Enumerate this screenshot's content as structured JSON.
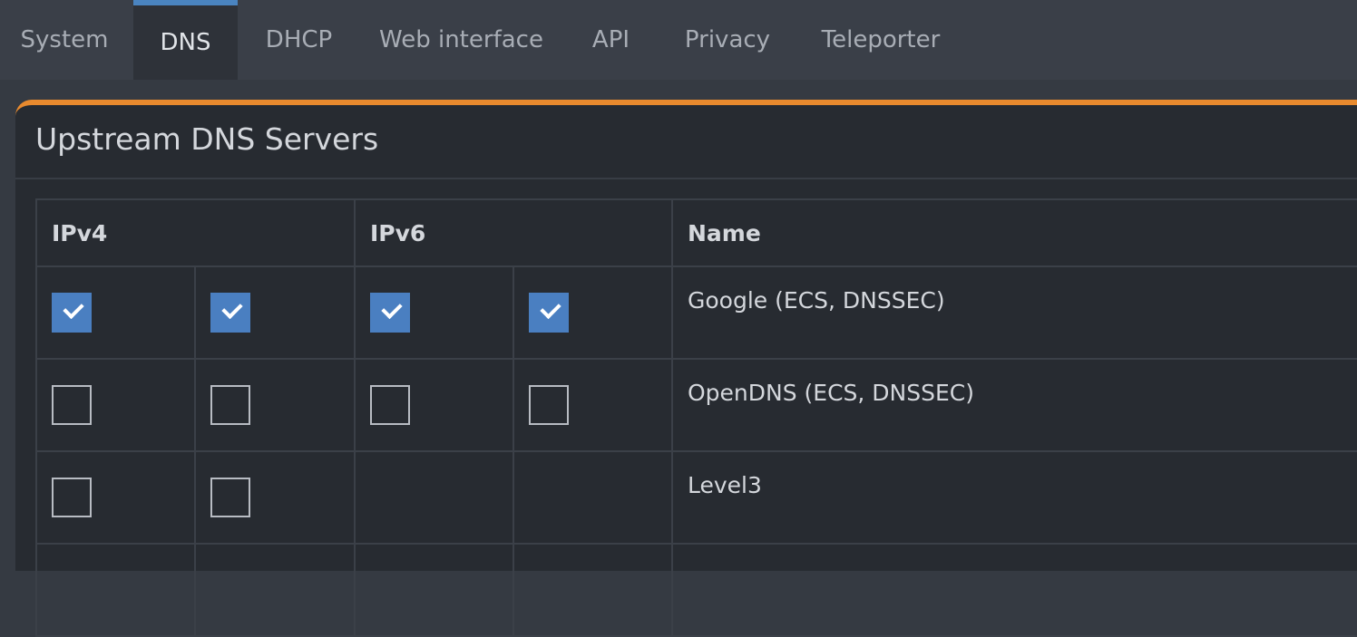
{
  "tabs": [
    {
      "label": "System",
      "active": false
    },
    {
      "label": "DNS",
      "active": true
    },
    {
      "label": "DHCP",
      "active": false
    },
    {
      "label": "Web interface",
      "active": false
    },
    {
      "label": "API",
      "active": false
    },
    {
      "label": "Privacy",
      "active": false
    },
    {
      "label": "Teleporter",
      "active": false
    }
  ],
  "box": {
    "title": "Upstream DNS Servers"
  },
  "table": {
    "headers": {
      "ipv4": "IPv4",
      "ipv6": "IPv6",
      "name": "Name"
    },
    "rows": [
      {
        "name": "Google (ECS, DNSSEC)",
        "ipv4_1": true,
        "ipv4_2": true,
        "ipv6_1": true,
        "ipv6_2": true
      },
      {
        "name": "OpenDNS (ECS, DNSSEC)",
        "ipv4_1": false,
        "ipv4_2": false,
        "ipv6_1": false,
        "ipv6_2": false
      },
      {
        "name": "Level3",
        "ipv4_1": false,
        "ipv4_2": false,
        "ipv6_1": null,
        "ipv6_2": null
      }
    ]
  },
  "colors": {
    "accent_orange": "#e88a2e",
    "accent_blue": "#4a84c0",
    "checkbox_checked": "#4a7fc1"
  }
}
